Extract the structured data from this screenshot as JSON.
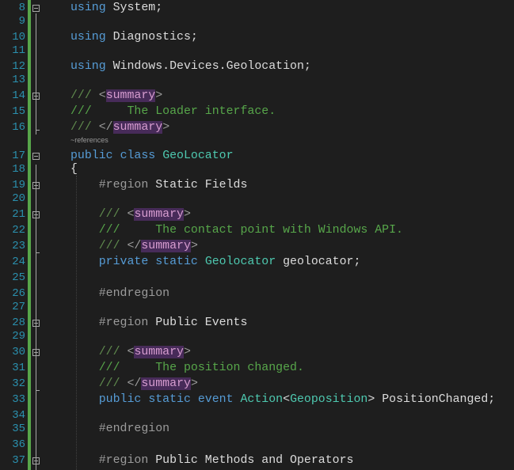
{
  "editor": {
    "colors": {
      "background": "#1e1e1e",
      "line_number": "#2b91af",
      "change_bar": "#57a64a",
      "keyword": "#569cd6",
      "type": "#4ec9b0",
      "comment": "#57a64a",
      "xml_doc_tag_highlight": "#472b59"
    },
    "codelens_references": "~references",
    "lines": [
      {
        "num": "8",
        "fold": "-",
        "tokens": [
          {
            "t": "using",
            "c": "kw"
          },
          {
            "t": " System;",
            "c": "pl"
          }
        ]
      },
      {
        "num": "9",
        "fold": "",
        "tokens": []
      },
      {
        "num": "10",
        "fold": "",
        "tokens": [
          {
            "t": "using",
            "c": "kw"
          },
          {
            "t": " Diagnostics;",
            "c": "pl"
          }
        ]
      },
      {
        "num": "11",
        "fold": "",
        "tokens": []
      },
      {
        "num": "12",
        "fold": "",
        "tokens": [
          {
            "t": "using",
            "c": "kw"
          },
          {
            "t": " Windows.Devices.Geolocation;",
            "c": "pl"
          }
        ]
      },
      {
        "num": "13",
        "fold": "",
        "tokens": []
      },
      {
        "num": "14",
        "fold": "-",
        "tokens": [
          {
            "t": "/// ",
            "c": "xd"
          },
          {
            "t": "<",
            "c": "xt"
          },
          {
            "t": "summary",
            "c": "xh"
          },
          {
            "t": ">",
            "c": "xt"
          }
        ]
      },
      {
        "num": "15",
        "fold": "",
        "tokens": [
          {
            "t": "///     The Loader interface.",
            "c": "cm"
          }
        ]
      },
      {
        "num": "16",
        "fold": "",
        "tokens": [
          {
            "t": "/// ",
            "c": "xd"
          },
          {
            "t": "</",
            "c": "xt"
          },
          {
            "t": "summary",
            "c": "xh"
          },
          {
            "t": ">",
            "c": "xt"
          }
        ]
      },
      {
        "num": "17",
        "fold": "-",
        "tokens": [
          {
            "t": "public",
            "c": "kw"
          },
          {
            "t": " ",
            "c": "pl"
          },
          {
            "t": "class",
            "c": "kw"
          },
          {
            "t": " ",
            "c": "pl"
          },
          {
            "t": "GeoLocator",
            "c": "ty"
          }
        ]
      },
      {
        "num": "18",
        "fold": "",
        "tokens": [
          {
            "t": "{",
            "c": "pl"
          }
        ]
      },
      {
        "num": "19",
        "fold": "-",
        "tokens": [
          {
            "t": "    ",
            "c": "pl"
          },
          {
            "t": "#region",
            "c": "pp"
          },
          {
            "t": " Static Fields",
            "c": "pl"
          }
        ]
      },
      {
        "num": "20",
        "fold": "",
        "tokens": []
      },
      {
        "num": "21",
        "fold": "-",
        "tokens": [
          {
            "t": "    ",
            "c": "pl"
          },
          {
            "t": "/// ",
            "c": "xd"
          },
          {
            "t": "<",
            "c": "xt"
          },
          {
            "t": "summary",
            "c": "xh"
          },
          {
            "t": ">",
            "c": "xt"
          }
        ]
      },
      {
        "num": "22",
        "fold": "",
        "tokens": [
          {
            "t": "    ",
            "c": "pl"
          },
          {
            "t": "///     The contact point with Windows API.",
            "c": "cm"
          }
        ]
      },
      {
        "num": "23",
        "fold": "",
        "tokens": [
          {
            "t": "    ",
            "c": "pl"
          },
          {
            "t": "/// ",
            "c": "xd"
          },
          {
            "t": "</",
            "c": "xt"
          },
          {
            "t": "summary",
            "c": "xh"
          },
          {
            "t": ">",
            "c": "xt"
          }
        ]
      },
      {
        "num": "24",
        "fold": "",
        "tokens": [
          {
            "t": "    ",
            "c": "pl"
          },
          {
            "t": "private",
            "c": "kw"
          },
          {
            "t": " ",
            "c": "pl"
          },
          {
            "t": "static",
            "c": "kw"
          },
          {
            "t": " ",
            "c": "pl"
          },
          {
            "t": "Geolocator",
            "c": "ty"
          },
          {
            "t": " geolocator;",
            "c": "pl"
          }
        ]
      },
      {
        "num": "25",
        "fold": "",
        "tokens": []
      },
      {
        "num": "26",
        "fold": "",
        "tokens": [
          {
            "t": "    ",
            "c": "pl"
          },
          {
            "t": "#endregion",
            "c": "pp"
          }
        ]
      },
      {
        "num": "27",
        "fold": "",
        "tokens": []
      },
      {
        "num": "28",
        "fold": "-",
        "tokens": [
          {
            "t": "    ",
            "c": "pl"
          },
          {
            "t": "#region",
            "c": "pp"
          },
          {
            "t": " Public Events",
            "c": "pl"
          }
        ]
      },
      {
        "num": "29",
        "fold": "",
        "tokens": []
      },
      {
        "num": "30",
        "fold": "-",
        "tokens": [
          {
            "t": "    ",
            "c": "pl"
          },
          {
            "t": "/// ",
            "c": "xd"
          },
          {
            "t": "<",
            "c": "xt"
          },
          {
            "t": "summary",
            "c": "xh"
          },
          {
            "t": ">",
            "c": "xt"
          }
        ]
      },
      {
        "num": "31",
        "fold": "",
        "tokens": [
          {
            "t": "    ",
            "c": "pl"
          },
          {
            "t": "///     The position changed.",
            "c": "cm"
          }
        ]
      },
      {
        "num": "32",
        "fold": "",
        "tokens": [
          {
            "t": "    ",
            "c": "pl"
          },
          {
            "t": "/// ",
            "c": "xd"
          },
          {
            "t": "</",
            "c": "xt"
          },
          {
            "t": "summary",
            "c": "xh"
          },
          {
            "t": ">",
            "c": "xt"
          }
        ]
      },
      {
        "num": "33",
        "fold": "",
        "tokens": [
          {
            "t": "    ",
            "c": "pl"
          },
          {
            "t": "public",
            "c": "kw"
          },
          {
            "t": " ",
            "c": "pl"
          },
          {
            "t": "static",
            "c": "kw"
          },
          {
            "t": " ",
            "c": "pl"
          },
          {
            "t": "event",
            "c": "kw"
          },
          {
            "t": " ",
            "c": "pl"
          },
          {
            "t": "Action",
            "c": "ty"
          },
          {
            "t": "<",
            "c": "pl"
          },
          {
            "t": "Geoposition",
            "c": "ty"
          },
          {
            "t": "> PositionChanged;",
            "c": "pl"
          }
        ]
      },
      {
        "num": "34",
        "fold": "",
        "tokens": []
      },
      {
        "num": "35",
        "fold": "",
        "tokens": [
          {
            "t": "    ",
            "c": "pl"
          },
          {
            "t": "#endregion",
            "c": "pp"
          }
        ]
      },
      {
        "num": "36",
        "fold": "",
        "tokens": []
      },
      {
        "num": "37",
        "fold": "-",
        "tokens": [
          {
            "t": "    ",
            "c": "pl"
          },
          {
            "t": "#region",
            "c": "pp"
          },
          {
            "t": " Public Methods and Operators",
            "c": "pl"
          }
        ]
      }
    ]
  }
}
